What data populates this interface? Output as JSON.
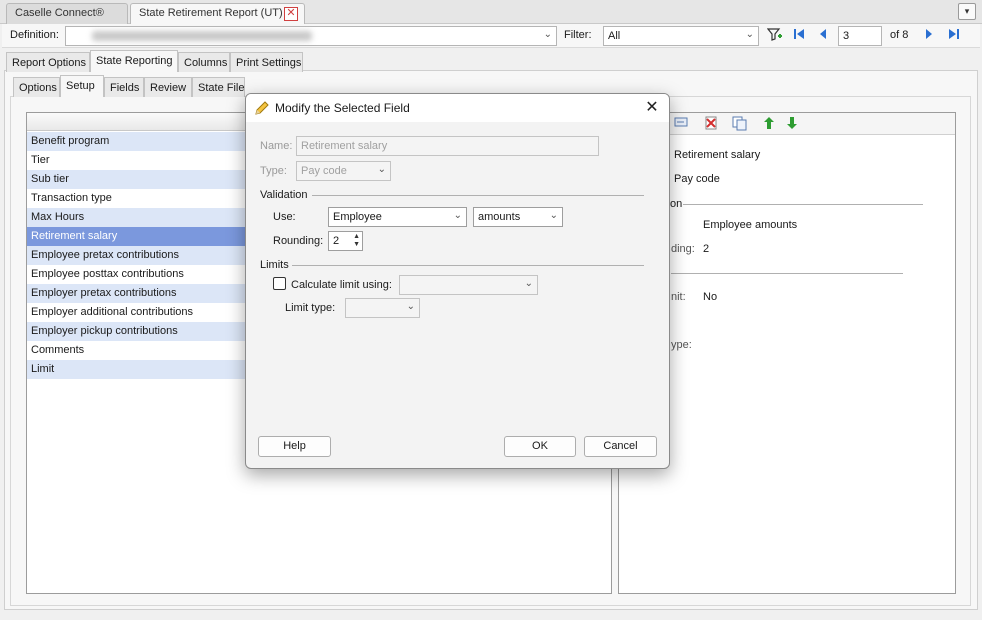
{
  "tabs": {
    "caselle": "Caselle Connect®",
    "report": "State Retirement Report (UT)",
    "close_glyph": "✕",
    "menu_glyph": "▾"
  },
  "toolbar": {
    "definition_label": "Definition:",
    "filter_label": "Filter:",
    "filter_value": "All",
    "page_value": "3",
    "page_total": "of 8",
    "icons": [
      "filter-add-icon",
      "first-page-icon",
      "prev-page-icon",
      "next-page-icon",
      "last-page-icon"
    ]
  },
  "main_tabs": [
    "Report Options",
    "State Reporting",
    "Columns",
    "Print Settings"
  ],
  "sub_tabs": [
    "Options",
    "Setup",
    "Fields",
    "Review",
    "State File"
  ],
  "fields": [
    "Benefit program",
    "Tier",
    "Sub tier",
    "Transaction type",
    "Max Hours",
    "Retirement salary",
    "Employee pretax contributions",
    "Employee posttax contributions",
    "Employer pretax contributions",
    "Employer additional contributions",
    "Employer pickup contributions",
    "Comments",
    "Limit"
  ],
  "selected_field": "Retirement salary",
  "preview": {
    "name": "Retirement salary",
    "type": "Pay code",
    "section_validation_fragment": "on",
    "use_value": "Employee amounts",
    "rounding_label_fragment": "ding:",
    "rounding_value": "2",
    "calc_limit_label_fragment": "nit:",
    "calc_limit_value": "No",
    "limit_type_label_fragment": "ype:"
  },
  "dialog": {
    "title": "Modify the Selected Field",
    "name_label": "Name:",
    "name_value": "Retirement salary",
    "type_label": "Type:",
    "type_value": "Pay code",
    "validation_section": "Validation",
    "use_label": "Use:",
    "use_value": "Employee",
    "amounts_value": "amounts",
    "rounding_label": "Rounding:",
    "rounding_value": "2",
    "limits_section": "Limits",
    "calc_limit_label": "Calculate limit using:",
    "limit_type_label": "Limit type:",
    "help_button": "Help",
    "ok_button": "OK",
    "cancel_button": "Cancel"
  }
}
